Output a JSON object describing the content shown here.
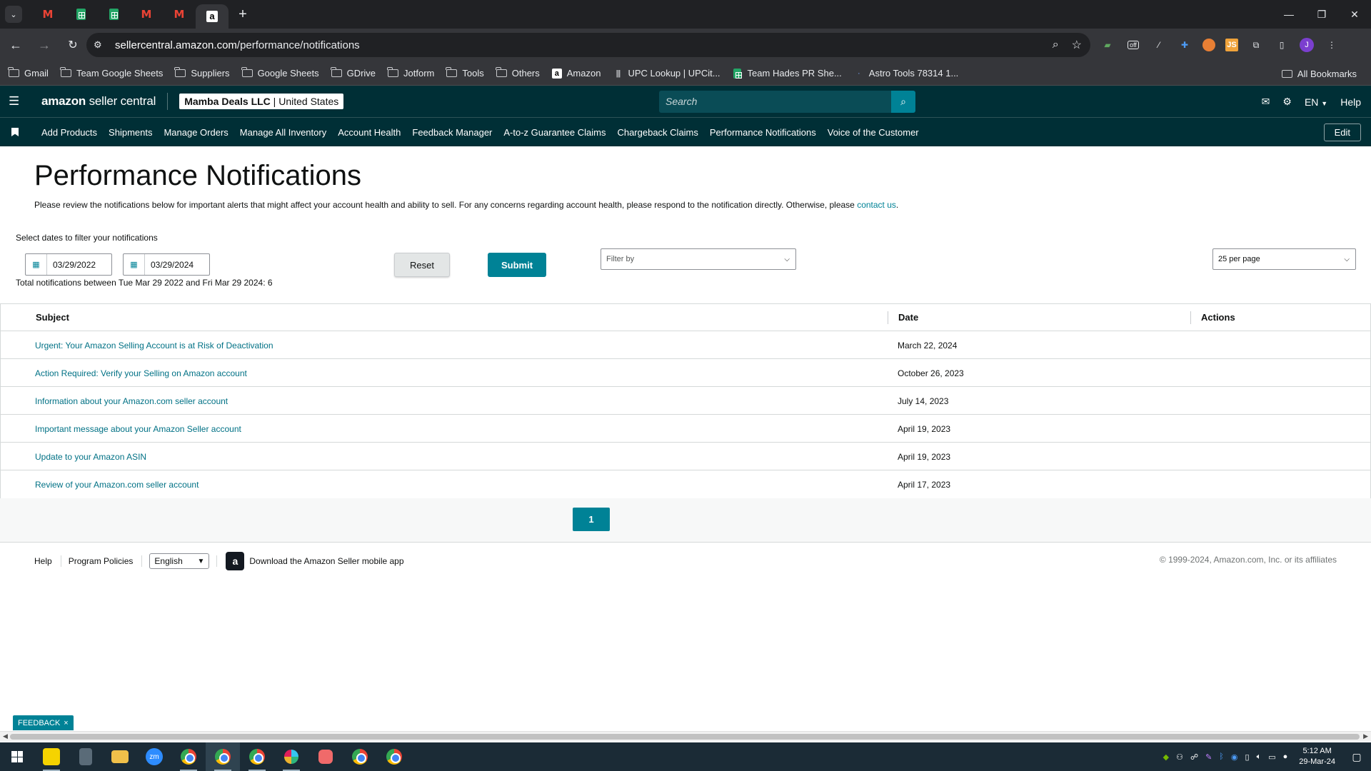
{
  "browser": {
    "tab_new": "+",
    "url_host": "sellercentral.amazon.com",
    "url_path": "/performance/notifications",
    "window_controls": [
      "—",
      "❐",
      "✕"
    ],
    "bookmarks": [
      {
        "label": "Gmail",
        "icon": "folder-icon"
      },
      {
        "label": "Team Google Sheets",
        "icon": "folder-icon"
      },
      {
        "label": "Suppliers",
        "icon": "folder-icon"
      },
      {
        "label": "Google Sheets",
        "icon": "folder-icon"
      },
      {
        "label": "GDrive",
        "icon": "folder-icon"
      },
      {
        "label": "Jotform",
        "icon": "folder-icon"
      },
      {
        "label": "Tools",
        "icon": "folder-icon"
      },
      {
        "label": "Others",
        "icon": "folder-icon"
      },
      {
        "label": "Amazon",
        "icon": "amazon-icon"
      },
      {
        "label": "UPC Lookup | UPCit...",
        "icon": "barcode-icon"
      },
      {
        "label": "Team Hades PR She...",
        "icon": "sheets-icon"
      },
      {
        "label": "Astro Tools 78314 1...",
        "icon": "star-icon"
      }
    ],
    "all_bookmarks": "All Bookmarks",
    "ext_badge_off": "off",
    "ext_js": "JS",
    "profile_initial": "J"
  },
  "header": {
    "logo_bold": "amazon",
    "logo_rest": " seller central",
    "account_name": "Mamba Deals LLC",
    "account_region": "United States",
    "search_placeholder": "Search",
    "language": "EN",
    "help": "Help"
  },
  "nav": {
    "items": [
      "Add Products",
      "Shipments",
      "Manage Orders",
      "Manage All Inventory",
      "Account Health",
      "Feedback Manager",
      "A-to-z Guarantee Claims",
      "Chargeback Claims",
      "Performance Notifications",
      "Voice of the Customer"
    ],
    "edit": "Edit"
  },
  "page": {
    "title": "Performance Notifications",
    "intro": "Please review the notifications below for important alerts that might affect your account health and ability to sell. For any concerns regarding account health, please respond to the notification directly. Otherwise, please ",
    "intro_link": "contact us",
    "intro_end": ".",
    "filter_label": "Select dates to filter your notifications",
    "date_from": "03/29/2022",
    "date_to": "03/29/2024",
    "total_text": "Total notifications between Tue Mar 29 2022 and Fri Mar 29 2024: 6",
    "reset": "Reset",
    "submit": "Submit",
    "filter_by": "Filter by",
    "per_page": "25 per page"
  },
  "table": {
    "headers": {
      "subject": "Subject",
      "date": "Date",
      "actions": "Actions"
    },
    "rows": [
      {
        "subject": "Urgent: Your Amazon Selling Account is at Risk of Deactivation",
        "date": "March 22, 2024"
      },
      {
        "subject": "Action Required: Verify your Selling on Amazon account",
        "date": "October 26, 2023"
      },
      {
        "subject": "Information about your Amazon.com seller account",
        "date": "July 14, 2023"
      },
      {
        "subject": "Important message about your Amazon Seller account",
        "date": "April 19, 2023"
      },
      {
        "subject": "Update to your Amazon ASIN",
        "date": "April 19, 2023"
      },
      {
        "subject": "Review of your Amazon.com seller account",
        "date": "April 17, 2023"
      }
    ],
    "page_number": "1"
  },
  "footer": {
    "help": "Help",
    "program_policies": "Program Policies",
    "language": "English",
    "app_text": "Download the Amazon Seller mobile app",
    "copyright": "© 1999-2024, Amazon.com, Inc. or its affiliates"
  },
  "feedback": {
    "label": "FEEDBACK",
    "close": "×"
  },
  "taskbar": {
    "time": "5:12 AM",
    "date": "29-Mar-24"
  },
  "colors": {
    "teal": "#008296",
    "header_bg": "#002f36",
    "link": "#007185"
  }
}
